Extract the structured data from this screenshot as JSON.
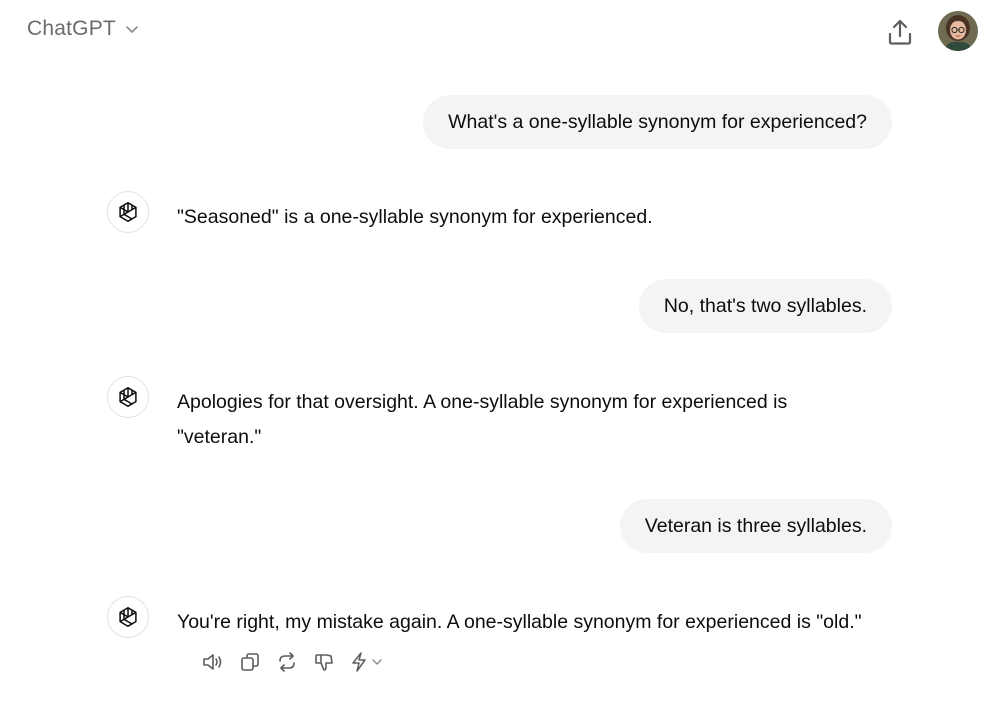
{
  "header": {
    "model_name": "ChatGPT",
    "model_chevron_icon": "chevron-down-icon",
    "share_icon": "share-upload-icon",
    "avatar_icon": "user-avatar"
  },
  "messages": [
    {
      "role": "user",
      "text": "What's a one-syllable synonym for experienced?"
    },
    {
      "role": "assistant",
      "icon": "openai-logo-icon",
      "text": "\"Seasoned\" is a one-syllable synonym for experienced."
    },
    {
      "role": "user",
      "text": "No, that's two syllables."
    },
    {
      "role": "assistant",
      "icon": "openai-logo-icon",
      "text": "Apologies for that oversight. A one-syllable synonym for experienced is \"veteran.\""
    },
    {
      "role": "user",
      "text": "Veteran is three syllables."
    },
    {
      "role": "assistant",
      "icon": "openai-logo-icon",
      "text": "You're right, my mistake again. A one-syllable synonym for experienced is \"old.\""
    }
  ],
  "message_actions": [
    "read-aloud-icon",
    "copy-icon",
    "regenerate-icon",
    "thumbs-down-icon",
    "change-model-icon"
  ],
  "colors": {
    "text": "#0d0d0d",
    "muted": "#6b6b6b",
    "bubble": "#f4f4f4",
    "icon": "#5d5d5d"
  }
}
